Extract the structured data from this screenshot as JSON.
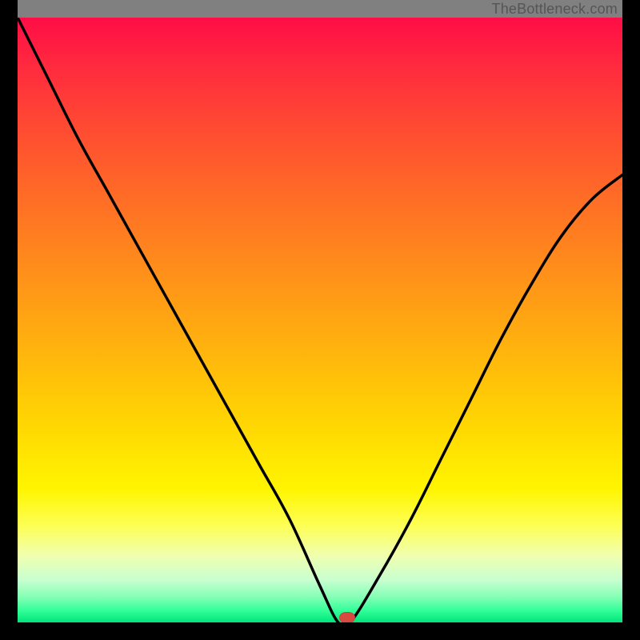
{
  "attribution": "TheBottleneck.com",
  "chart_data": {
    "type": "line",
    "x": [
      0.0,
      0.05,
      0.1,
      0.15,
      0.2,
      0.25,
      0.3,
      0.35,
      0.4,
      0.45,
      0.5,
      0.53,
      0.55,
      0.6,
      0.65,
      0.7,
      0.75,
      0.8,
      0.85,
      0.9,
      0.95,
      1.0
    ],
    "values": [
      100,
      90,
      80,
      71,
      62,
      53,
      44,
      35,
      26,
      17,
      6,
      0,
      0,
      8,
      17,
      27,
      37,
      47,
      56,
      64,
      70,
      74
    ],
    "title": "",
    "xlabel": "",
    "ylabel": "",
    "xlim": [
      0,
      1
    ],
    "ylim": [
      0,
      100
    ],
    "minimum_marker": {
      "x": 0.545,
      "y": 0
    },
    "gradient_stops": [
      {
        "pct": 0,
        "color": "#ff0d46"
      },
      {
        "pct": 8,
        "color": "#ff2a3e"
      },
      {
        "pct": 18,
        "color": "#ff4a32"
      },
      {
        "pct": 30,
        "color": "#ff6d26"
      },
      {
        "pct": 42,
        "color": "#ff8f1a"
      },
      {
        "pct": 54,
        "color": "#ffb10e"
      },
      {
        "pct": 66,
        "color": "#ffd303"
      },
      {
        "pct": 78,
        "color": "#fff500"
      },
      {
        "pct": 84,
        "color": "#fdff55"
      },
      {
        "pct": 89,
        "color": "#f0ffb0"
      },
      {
        "pct": 93,
        "color": "#c8ffd0"
      },
      {
        "pct": 96,
        "color": "#7effb4"
      },
      {
        "pct": 98,
        "color": "#33ff99"
      },
      {
        "pct": 100,
        "color": "#00e57a"
      }
    ]
  }
}
